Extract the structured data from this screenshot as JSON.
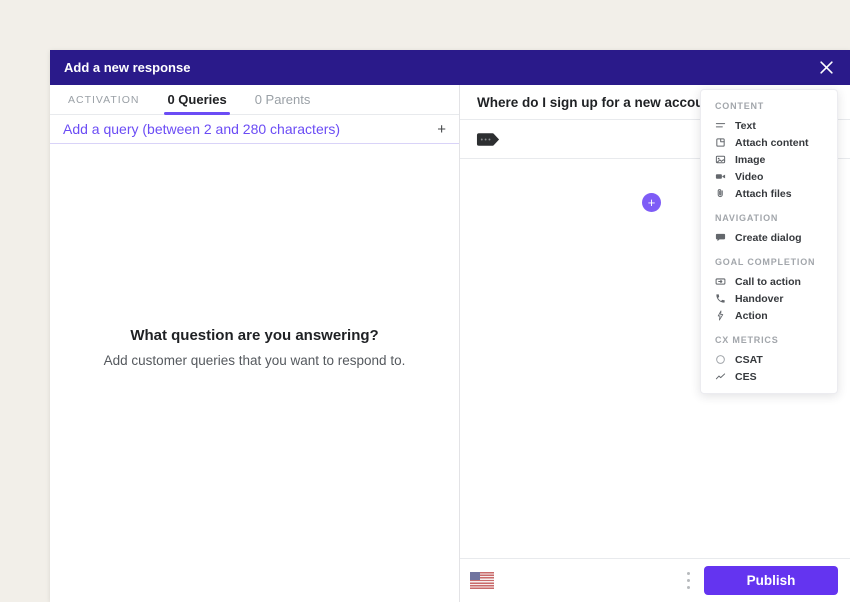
{
  "modal": {
    "title": "Add a new response"
  },
  "tabs": [
    {
      "label": "ACTIVATION",
      "active": false
    },
    {
      "label": "0 Queries",
      "active": true
    },
    {
      "label": "0 Parents",
      "active": false
    }
  ],
  "left_panel": {
    "add_query_label": "Add a query (between 2 and 280 characters)",
    "empty_title": "What question are you answering?",
    "empty_subtitle": "Add customer queries that you want to respond to."
  },
  "right_panel": {
    "question_title": "Where do I sign up for a new account?"
  },
  "menu": {
    "sections": [
      {
        "label": "CONTENT",
        "items": [
          {
            "icon": "text-icon",
            "label": "Text"
          },
          {
            "icon": "attach-content-icon",
            "label": "Attach content"
          },
          {
            "icon": "image-icon",
            "label": "Image"
          },
          {
            "icon": "video-icon",
            "label": "Video"
          },
          {
            "icon": "attach-files-icon",
            "label": "Attach files"
          }
        ]
      },
      {
        "label": "NAVIGATION",
        "items": [
          {
            "icon": "create-dialog-icon",
            "label": "Create dialog"
          }
        ]
      },
      {
        "label": "GOAL COMPLETION",
        "items": [
          {
            "icon": "call-to-action-icon",
            "label": "Call to action"
          },
          {
            "icon": "handover-icon",
            "label": "Handover"
          },
          {
            "icon": "action-icon",
            "label": "Action"
          }
        ]
      },
      {
        "label": "CX METRICS",
        "items": [
          {
            "icon": "csat-icon",
            "label": "CSAT"
          },
          {
            "icon": "ces-icon",
            "label": "CES"
          }
        ]
      }
    ]
  },
  "footer": {
    "language_flag": "us-flag",
    "publish_label": "Publish"
  },
  "icons": {
    "plus": "+",
    "kebab": "⋮",
    "close": "✕"
  },
  "colors": {
    "header_bg": "#2a1a8a",
    "accent": "#6b4cf5",
    "publish": "#6434f0",
    "plus_circle": "#7e5cf6",
    "page_bg": "#f2efe9"
  }
}
